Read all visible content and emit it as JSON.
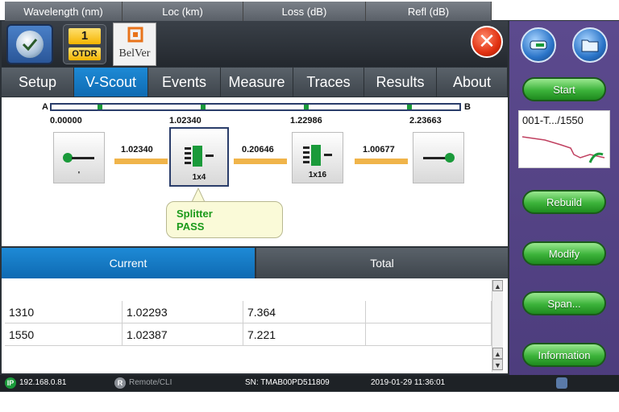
{
  "header": {
    "otdr_number": "1",
    "otdr_label": "OTDR",
    "logo_text": "BelVer",
    "close_symbol": "✕"
  },
  "tabs": [
    {
      "label": "Setup"
    },
    {
      "label": "V-Scout",
      "active": true
    },
    {
      "label": "Events"
    },
    {
      "label": "Measure"
    },
    {
      "label": "Traces"
    },
    {
      "label": "Results"
    },
    {
      "label": "About"
    }
  ],
  "map": {
    "start_label": "A",
    "end_label": "B",
    "positions": [
      "0.00000",
      "1.02340",
      "1.22986",
      "2.23663"
    ],
    "link_values": [
      "1.02340",
      "0.20646",
      "1.00677"
    ],
    "nodes": [
      {
        "caption": "'"
      },
      {
        "caption": "1x4",
        "selected": true
      },
      {
        "caption": "1x16"
      },
      {
        "caption": ""
      }
    ],
    "bubble": {
      "line1": "Splitter",
      "line2": "PASS"
    }
  },
  "subtabs": {
    "current": "Current",
    "total": "Total"
  },
  "table": {
    "headers": [
      "Wavelength (nm)",
      "Loc (km)",
      "Loss (dB)",
      "Refl (dB)"
    ],
    "rows": [
      [
        "1310",
        "1.02293",
        "7.364",
        ""
      ],
      [
        "1550",
        "1.02387",
        "7.221",
        ""
      ]
    ]
  },
  "side": {
    "start": "Start",
    "thumb_title": "001-T.../1550",
    "rebuild": "Rebuild",
    "modify": "Modify",
    "span": "Span...",
    "information": "Information"
  },
  "status": {
    "ip": "192.168.0.81",
    "remote": "Remote/CLI",
    "sn": "SN: TMAB00PD511809",
    "datetime": "2019-01-29  11:36:01",
    "ip_badge": "IP",
    "remote_badge": "R"
  },
  "colors": {
    "accent": "#0e6ab2",
    "link": "#f0b44a",
    "pass": "#1a9a1a",
    "pill": "#3cb33a",
    "panel": "#4c3c7c"
  }
}
